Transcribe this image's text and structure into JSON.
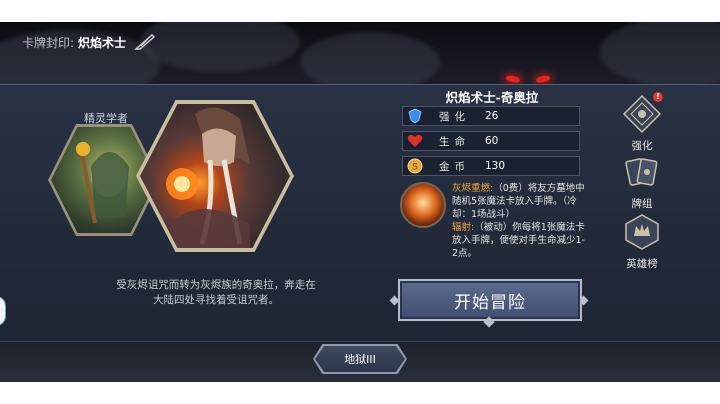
{
  "header": {
    "label": "卡牌封印:",
    "name": "炽焰术士"
  },
  "portraits": {
    "secondary_name": "精灵学者"
  },
  "description_lines": [
    "受灰烬诅咒而转为灰烬族的奇奥拉，奔走在",
    "大陆四处寻找着受诅咒者。"
  ],
  "character": {
    "title": "炽焰术士-奇奥拉",
    "stats": [
      {
        "label": "强化",
        "value": "26",
        "icon": "blue-shield-icon",
        "color": "#3a8ee8"
      },
      {
        "label": "生命",
        "value": "60",
        "icon": "red-heart-icon",
        "color": "#e0302a"
      },
      {
        "label": "金币",
        "value": "130",
        "icon": "gold-coin-icon",
        "color": "#e8a93a"
      }
    ]
  },
  "skills": [
    {
      "name": "灰烬重燃:",
      "text": "（0费）将友方墓地中随机5张魔法卡放入手牌。（冷却：1场战斗）"
    },
    {
      "name": "辐射:",
      "text": "（被动）你每将1张魔法卡放入手牌，便使对手生命减少1-2点。"
    }
  ],
  "actions": {
    "start_label": "开始冒险",
    "difficulty_label": "地狱III"
  },
  "side_menu": [
    {
      "label": "强化",
      "icon": "upgrade-compass-icon",
      "badge": "!"
    },
    {
      "label": "牌组",
      "icon": "card-deck-icon"
    },
    {
      "label": "英雄榜",
      "icon": "hero-ranking-icon"
    }
  ]
}
